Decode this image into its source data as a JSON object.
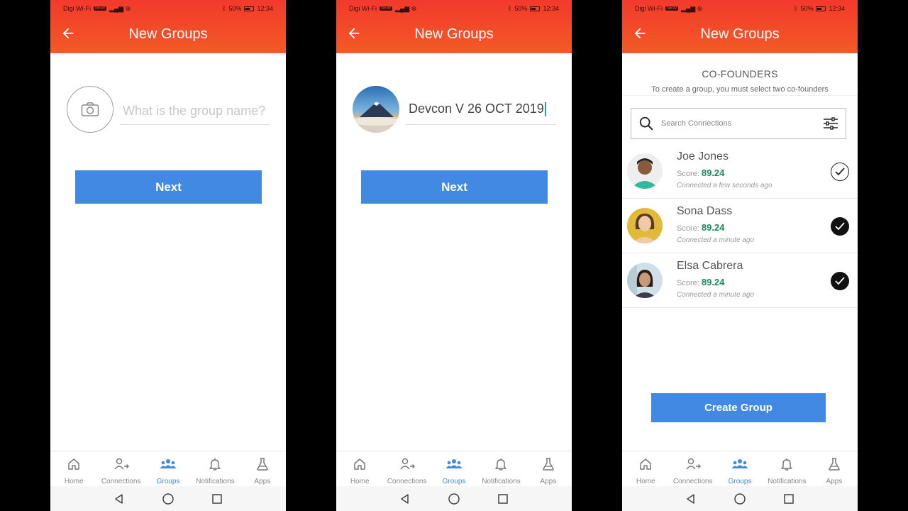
{
  "status": {
    "carrier": "Digi Wi-Fi",
    "wifi_tag": "NEW",
    "battery": "50%",
    "time": "12:34"
  },
  "header": {
    "title": "New Groups"
  },
  "screen1": {
    "name_placeholder": "What is the group name?",
    "next_label": "Next"
  },
  "screen2": {
    "group_name": "Devcon V 26 OCT 2019",
    "next_label": "Next"
  },
  "screen3": {
    "section_title": "CO-FOUNDERS",
    "section_subtitle": "To create a group, you must select two co-founders",
    "search_placeholder": "Search Connections",
    "score_label": "Score:",
    "connections": [
      {
        "name": "Joe Jones",
        "score": "89.24",
        "time": "Connected a few seconds ago",
        "selected": false
      },
      {
        "name": "Sona Dass",
        "score": "89.24",
        "time": "Connected a minute ago",
        "selected": true
      },
      {
        "name": "Elsa Cabrera",
        "score": "89.24",
        "time": "Connected a minute ago",
        "selected": true
      }
    ],
    "create_label": "Create Group"
  },
  "nav": {
    "items": [
      {
        "label": "Home",
        "icon": "home-icon"
      },
      {
        "label": "Connections",
        "icon": "connections-icon"
      },
      {
        "label": "Groups",
        "icon": "groups-icon",
        "active": true
      },
      {
        "label": "Notifications",
        "icon": "bell-icon"
      },
      {
        "label": "Apps",
        "icon": "flask-icon"
      }
    ]
  },
  "colors": {
    "header_top": "#f23a2c",
    "header_bottom": "#f35a26",
    "primary": "#4189e2",
    "score": "#1b8a5a"
  }
}
